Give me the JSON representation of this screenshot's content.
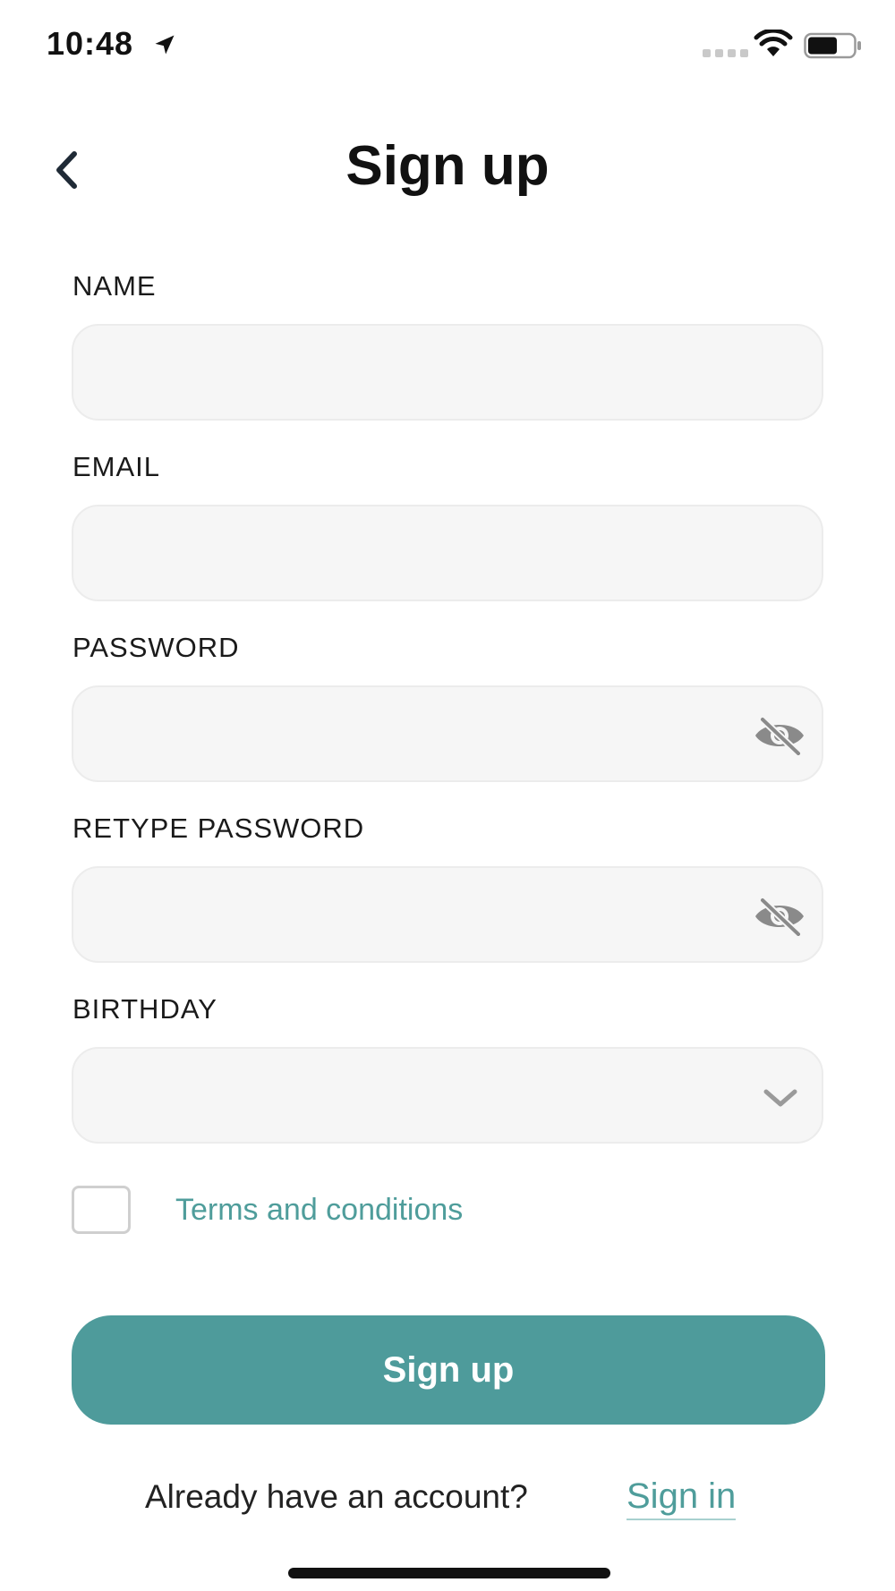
{
  "status_bar": {
    "time": "10:48",
    "location_icon": "location-arrow-icon",
    "wifi_icon": "wifi-icon",
    "battery_icon": "battery-icon"
  },
  "header": {
    "back_icon": "chevron-left-icon",
    "title": "Sign up"
  },
  "form": {
    "name_label": "NAME",
    "name_value": "",
    "email_label": "EMAIL",
    "email_value": "",
    "password_label": "PASSWORD",
    "password_value": "",
    "retype_password_label": "RETYPE PASSWORD",
    "retype_password_value": "",
    "birthday_label": "BIRTHDAY",
    "birthday_value": "",
    "visibility_icon": "eye-off-icon",
    "dropdown_icon": "chevron-down-icon"
  },
  "terms": {
    "checked": false,
    "label": "Terms and conditions"
  },
  "primary_button": {
    "label": "Sign up"
  },
  "footer": {
    "prompt": "Already have an account?",
    "signin_label": "Sign in"
  },
  "colors": {
    "accent": "#4e9b9b",
    "link": "#4f9d9b",
    "field_bg": "#f6f6f6",
    "field_border": "#ececec",
    "text": "#111111"
  }
}
